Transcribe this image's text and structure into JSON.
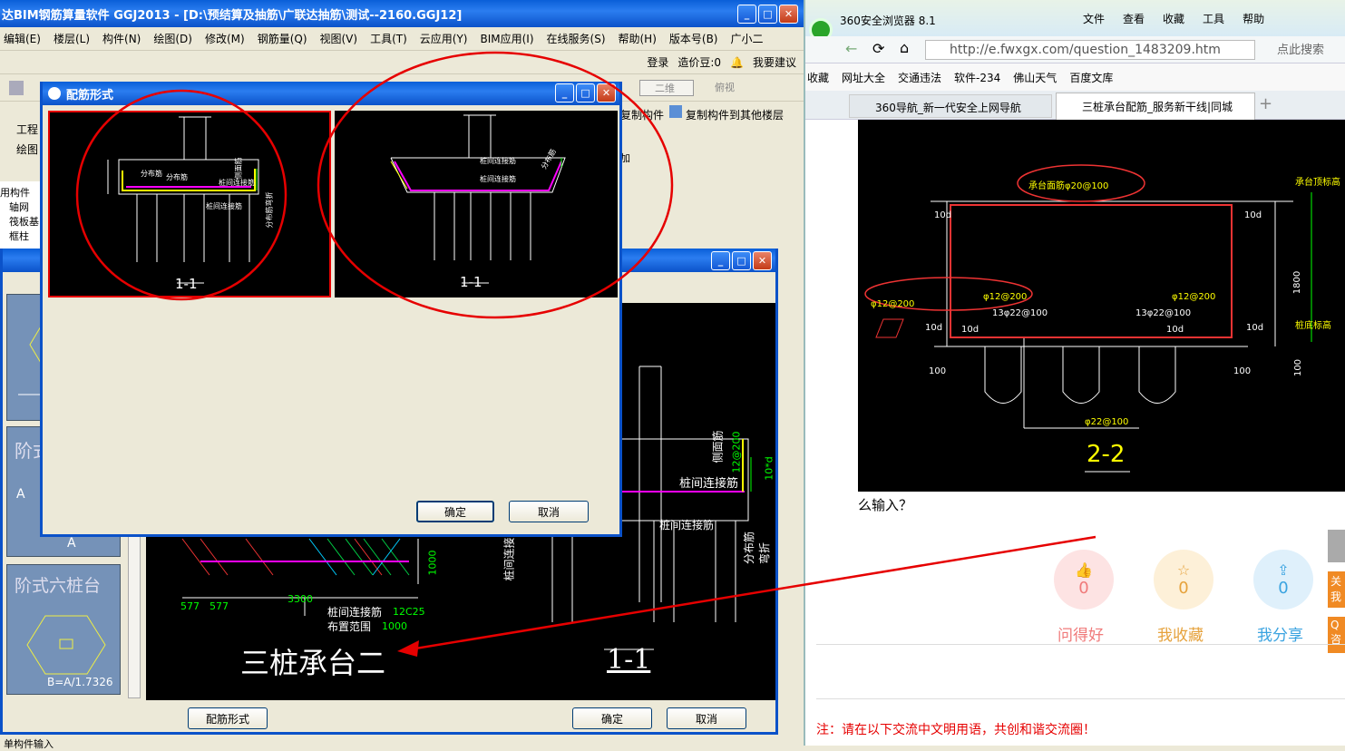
{
  "app": {
    "title": "达BIM钢筋算量软件 GGJ2013 - [D:\\预结算及抽筋\\广联达抽筋\\测试--2160.GGJ12]",
    "menu": [
      "编辑(E)",
      "楼层(L)",
      "构件(N)",
      "绘图(D)",
      "修改(M)",
      "钢筋量(Q)",
      "视图(V)",
      "工具(T)",
      "云应用(Y)",
      "BIM应用(I)",
      "在线服务(S)",
      "帮助(H)",
      "版本号(B)",
      "广小二"
    ],
    "login": "登录",
    "cost_beans": "造价豆:0",
    "suggest": "我要建议",
    "view_2d": "二维",
    "view_top": "俯视",
    "copy_component": "复制构件",
    "copy_to_floor": "复制构件到其他楼层",
    "left_tabs": [
      "工程",
      "绘图"
    ],
    "tree_header": "用构件",
    "tree_items": [
      "轴网",
      "筏板基",
      "框柱",
      "..."
    ],
    "add_label": "加",
    "bottom_text": "单构件输入"
  },
  "rebar_dialog": {
    "title": "配筋形式",
    "left_caption": "1-1",
    "right_caption": "1-1",
    "left_labels": [
      "分布筋",
      "分布筋",
      "桩间连接筋",
      "桩间连接筋",
      "侧面筋",
      "分布筋弯折"
    ],
    "right_labels": [
      "桩间连接筋",
      "桩间连接筋",
      "分布筋"
    ],
    "ok": "确定",
    "cancel": "取消"
  },
  "cap_dialog": {
    "thumbs": [
      "A",
      "A",
      "阶式",
      "阶式六桩台",
      "B=A/1.7326"
    ],
    "caption_main": "三桩承台二",
    "section": "1-1",
    "dims": [
      "577",
      "577",
      "3300",
      "1000",
      "桩间连接筋",
      "12C25",
      "布置范围",
      "1000"
    ],
    "side_labels": [
      "桩间连接筋",
      "侧面筋",
      "12@200",
      "10*d",
      "桩间连接筋",
      "分布筋弯折",
      "桩间连接"
    ],
    "btn_form": "配筋形式",
    "ok": "确定",
    "cancel": "取消"
  },
  "browser": {
    "title": "360安全浏览器 8.1",
    "menu": [
      "文件",
      "查看",
      "收藏",
      "工具",
      "帮助"
    ],
    "url": "http://e.fwxgx.com/question_1483209.htm",
    "search_placeholder": "点此搜索",
    "bookmarks": [
      "收藏",
      "网址大全",
      "交通违法",
      "软件-234",
      "佛山天气",
      "百度文库"
    ],
    "tabs": [
      "360导航_新一代安全上网导航",
      "三桩承台配筋_服务新干线|同城"
    ],
    "drawing": {
      "top_label": "承台面筋φ20@100",
      "right_label": "承台顶标高",
      "dims": [
        "10d",
        "10d",
        "φ12@200",
        "φ12@200",
        "φ12@200",
        "13φ22@100",
        "13φ22@100",
        "10d",
        "10d",
        "10d",
        "10d",
        "1800",
        "桩底标高",
        "100",
        "100",
        "100",
        "φ22@100",
        "2-2"
      ]
    },
    "question_tail": "么输入？",
    "actions": [
      {
        "label": "问得好",
        "count": "0",
        "color": "#f07a7a"
      },
      {
        "label": "我收藏",
        "count": "0",
        "color": "#e6a23c"
      },
      {
        "label": "我分享",
        "count": "0",
        "color": "#3aa3e0"
      }
    ],
    "side_tabs": [
      "关我",
      "Q咨"
    ],
    "notice": "注：请在以下交流中文明用语，共创和谐交流圈！"
  },
  "colors": {
    "annotation": "#e60000",
    "xp_blue": "#0b52c9"
  }
}
